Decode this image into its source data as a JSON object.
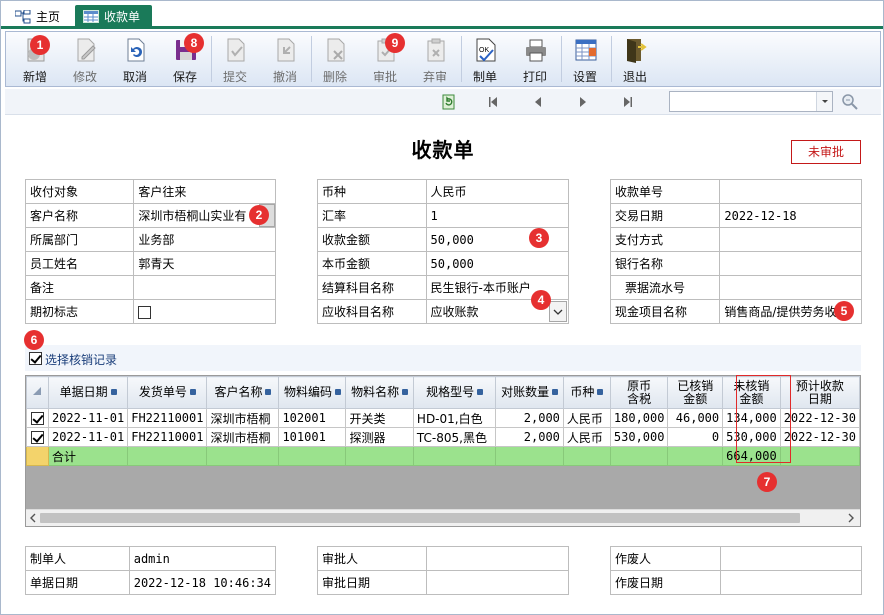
{
  "tabs": [
    {
      "label": "主页"
    },
    {
      "label": "收款单"
    }
  ],
  "toolbar": {
    "buttons": [
      {
        "label": "新增",
        "enabled": true
      },
      {
        "label": "修改",
        "enabled": false
      },
      {
        "label": "取消",
        "enabled": true
      },
      {
        "label": "保存",
        "enabled": true
      },
      {
        "label": "提交",
        "enabled": false
      },
      {
        "label": "撤消",
        "enabled": false
      },
      {
        "label": "删除",
        "enabled": false
      },
      {
        "label": "审批",
        "enabled": false
      },
      {
        "label": "弃审",
        "enabled": false
      },
      {
        "label": "制单",
        "enabled": true
      },
      {
        "label": "打印",
        "enabled": true
      },
      {
        "label": "设置",
        "enabled": true
      },
      {
        "label": "退出",
        "enabled": true
      }
    ]
  },
  "search": {
    "value": ""
  },
  "doc": {
    "title": "收款单",
    "status": "未审批"
  },
  "left_form": [
    {
      "label": "收付对象",
      "value": "客户往来"
    },
    {
      "label": "客户名称",
      "value": "深圳市梧桐山实业有"
    },
    {
      "label": "所属部门",
      "value": "业务部"
    },
    {
      "label": "员工姓名",
      "value": "郭青天"
    },
    {
      "label": "备注",
      "value": ""
    },
    {
      "label": "期初标志",
      "value": ""
    }
  ],
  "middle_form": [
    {
      "label": "币种",
      "value": "人民币"
    },
    {
      "label": "汇率",
      "value": "1"
    },
    {
      "label": "收款金额",
      "value": "50,000"
    },
    {
      "label": "本币金额",
      "value": "50,000"
    },
    {
      "label": "结算科目名称",
      "value": "民生银行-本币账户"
    },
    {
      "label": "应收科目名称",
      "value": "应收账款"
    }
  ],
  "right_form": [
    {
      "label": "收款单号",
      "value": ""
    },
    {
      "label": "交易日期",
      "value": "2022-12-18"
    },
    {
      "label": "支付方式",
      "value": ""
    },
    {
      "label": "银行名称",
      "value": ""
    },
    {
      "label": "票据流水号",
      "value": ""
    },
    {
      "label": "现金项目名称",
      "value": "销售商品/提供劳务收"
    }
  ],
  "select_records": {
    "label": "选择核销记录",
    "checked": true
  },
  "grid": {
    "headers": [
      "单据日期",
      "发货单号",
      "客户名称",
      "物料编码",
      "物料名称",
      "规格型号",
      "对账数量",
      "币种",
      "原币\n含税",
      "已核销\n金额",
      "未核销\n金额",
      "预计收款\n日期"
    ],
    "rows": [
      {
        "checked": true,
        "cells": [
          "2022-11-01",
          "FH22110001",
          "深圳市梧桐",
          "102001",
          "开关类",
          "HD-01,白色",
          "2,000",
          "人民币",
          "180,000",
          "46,000",
          "134,000",
          "2022-12-30"
        ]
      },
      {
        "checked": true,
        "cells": [
          "2022-11-01",
          "FH22110001",
          "深圳市梧桐",
          "101001",
          "探测器",
          "TC-805,黑色",
          "2,000",
          "人民币",
          "530,000",
          "0",
          "530,000",
          "2022-12-30"
        ]
      }
    ],
    "total": {
      "label": "合计",
      "unsettled": "664,000"
    }
  },
  "bottom_left": [
    {
      "label": "制单人",
      "value": "admin"
    },
    {
      "label": "单据日期",
      "value": "2022-12-18 10:46:34"
    }
  ],
  "bottom_middle": [
    {
      "label": "审批人",
      "value": ""
    },
    {
      "label": "审批日期",
      "value": ""
    }
  ],
  "bottom_right": [
    {
      "label": "作废人",
      "value": ""
    },
    {
      "label": "作废日期",
      "value": ""
    }
  ],
  "annotations": [
    "1",
    "2",
    "3",
    "4",
    "5",
    "6",
    "7",
    "8",
    "9"
  ]
}
